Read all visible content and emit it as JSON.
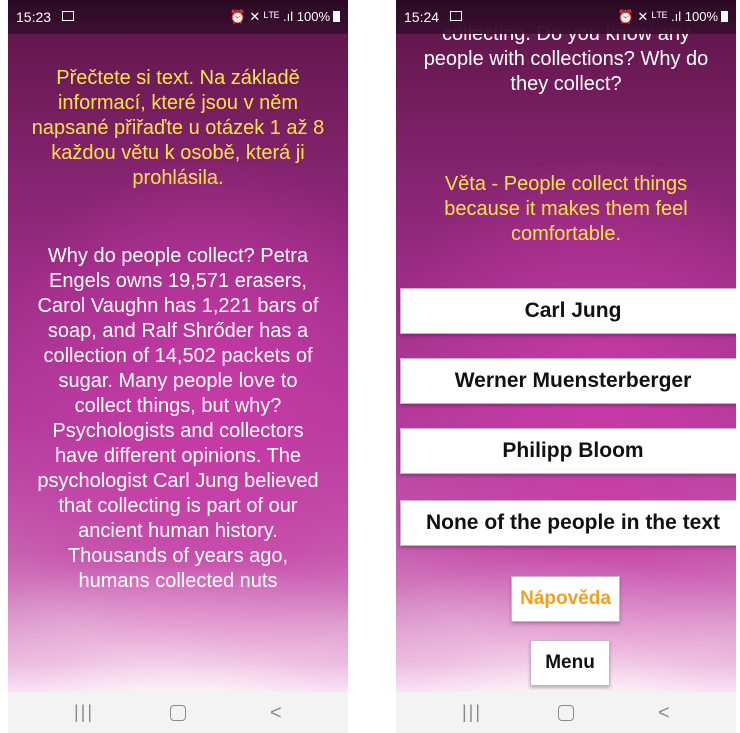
{
  "left_phone": {
    "status": {
      "time": "15:23",
      "icons": "⏰ ✕ ᴸᵀᴱ .ıl",
      "battery_text": "100%"
    },
    "instruction": "Přečtete si text. Na základě informací, které jsou v něm napsané přiřaďte u otázek 1 až 8 každou větu k osobě, která ji prohlásila.",
    "story": "Why do people collect? Petra Engels owns 19,571 erasers, Carol Vaughn has 1,221 bars of soap, and Ralf Shrőder has a collection of 14,502 packets of sugar. Many people love to collect things, but why? Psychologists and collectors have different opinions. The psychologist Carl Jung believed that collecting is part of our ancient human history. Thousands of years ago, humans collected nuts"
  },
  "right_phone": {
    "status": {
      "time": "15:24",
      "icons": "⏰ ✕ ᴸᵀᴱ .ıl",
      "battery_text": "100%"
    },
    "question_tail": "collecting. Do you know any people with collections? Why do they collect?",
    "veta": "Věta - People collect things because it makes them feel comfortable.",
    "answers": [
      "Carl Jung",
      "Werner Muensterberger",
      "Philipp Bloom",
      "None of the people in the text"
    ],
    "hint_button": "Nápověda",
    "menu_button": "Menu",
    "hint_color": "#f0a020"
  },
  "navbar": {
    "recent": "|||",
    "back": "<"
  }
}
